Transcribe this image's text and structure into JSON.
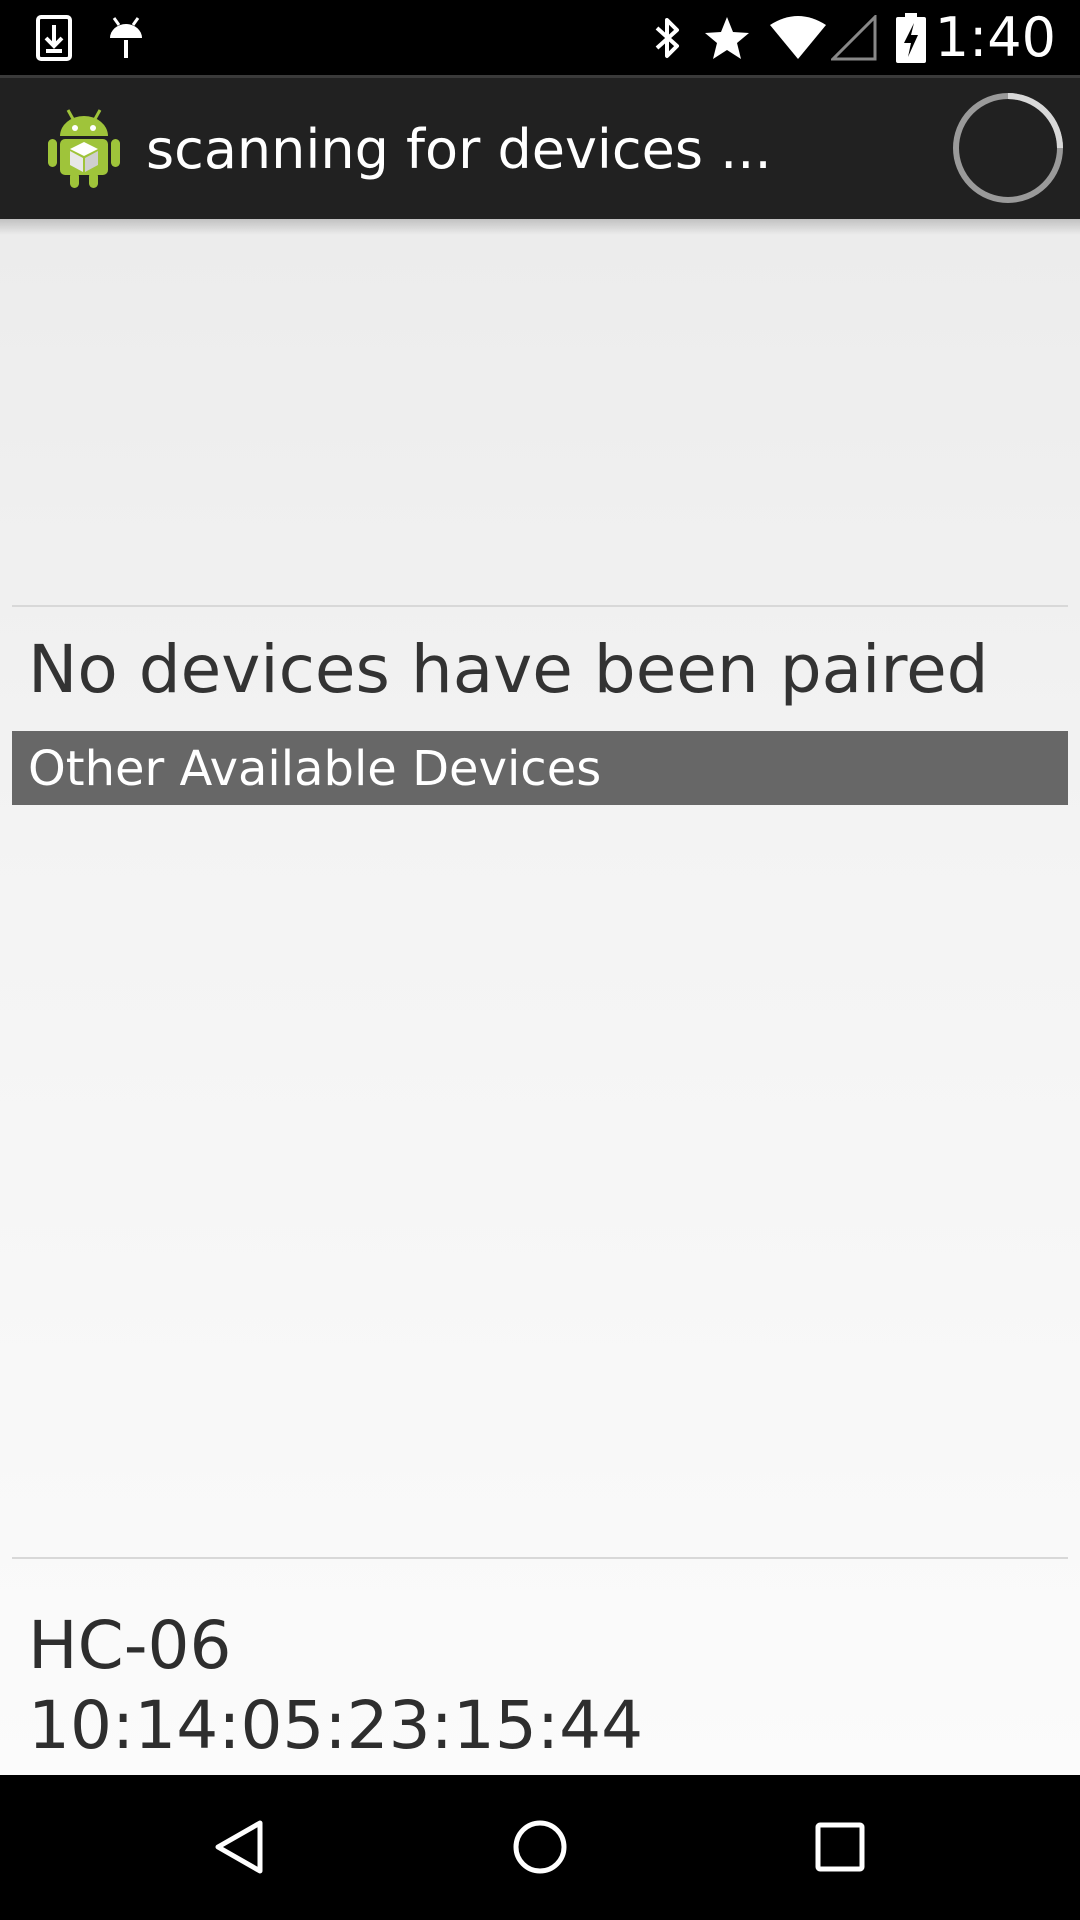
{
  "status_bar": {
    "time": "1:40",
    "left_icons": [
      "download-icon",
      "android-debug-icon"
    ],
    "right_icons": [
      "bluetooth-icon",
      "star-icon",
      "wifi-icon",
      "signal-icon",
      "battery-charging-icon"
    ]
  },
  "action_bar": {
    "title": "scanning for devices ...",
    "icon": "android-app-icon",
    "progress_icon": "spinner-icon"
  },
  "paired_devices": {
    "empty_text": "No devices have been paired"
  },
  "other_devices": {
    "header": "Other Available Devices",
    "items": [
      {
        "name": "HC-06",
        "address": "10:14:05:23:15:44"
      }
    ]
  },
  "nav_bar": {
    "buttons": [
      "back-icon",
      "home-icon",
      "recents-icon"
    ]
  },
  "colors": {
    "status_bar": "#000000",
    "action_bar": "#212121",
    "section_header": "#676767",
    "android_green": "#9fc43a"
  }
}
